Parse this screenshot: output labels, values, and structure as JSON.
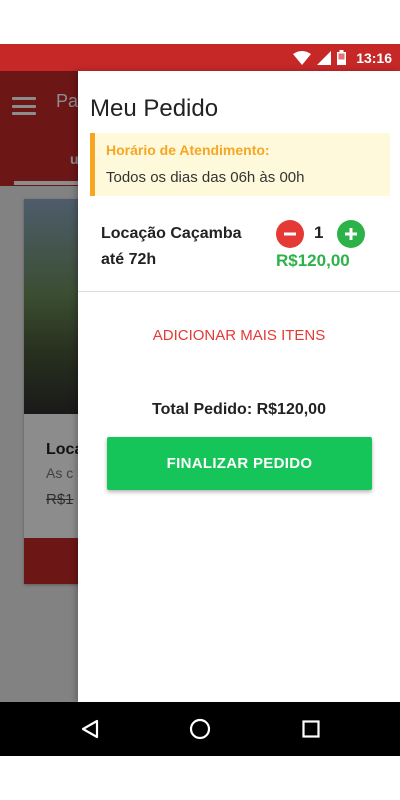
{
  "status_bar": {
    "time": "13:16",
    "icons": [
      "wifi-icon",
      "signal-icon",
      "battery-icon"
    ]
  },
  "background_app": {
    "title": "Pa",
    "tab": "u",
    "card": {
      "title": "Loca",
      "subtitle": "As c",
      "price": "R$1"
    }
  },
  "drawer": {
    "title": "Meu Pedido",
    "hours": {
      "label": "Horário de Atendimento:",
      "text": "Todos os dias das 06h às 00h"
    },
    "item": {
      "name": "Locação Caçamba até 72h",
      "quantity": "1",
      "price": "R$120,00"
    },
    "add_more_label": "ADICIONAR MAIS ITENS",
    "total_label": "Total Pedido: R$120,00",
    "finish_label": "FINALIZAR PEDIDO"
  },
  "colors": {
    "brand_red": "#c62828",
    "accent_green": "#2db24a",
    "button_green": "#15c55a",
    "warning_orange": "#f5a623"
  },
  "nav_bar": {
    "buttons": [
      "back-icon",
      "home-icon",
      "recents-icon"
    ]
  }
}
